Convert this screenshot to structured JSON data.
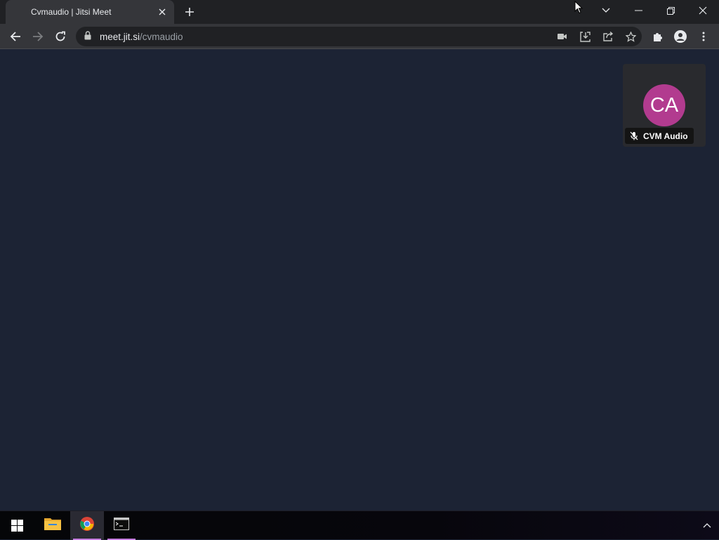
{
  "browser": {
    "tab": {
      "title": "Cvmaudio | Jitsi Meet"
    },
    "address": {
      "host": "meet.jit.si",
      "path": "/cvmaudio"
    }
  },
  "meeting": {
    "participant": {
      "initials": "CA",
      "name": "CVM Audio",
      "avatar_color": "#b23b8f",
      "muted": true
    }
  },
  "taskbar": {
    "apps": [
      "windows-start",
      "file-explorer",
      "google-chrome",
      "command-prompt"
    ],
    "active_app": "google-chrome"
  },
  "colors": {
    "meeting_bg": "#1c2334",
    "tab_bg": "#35363a",
    "accent": "#c57de0"
  }
}
